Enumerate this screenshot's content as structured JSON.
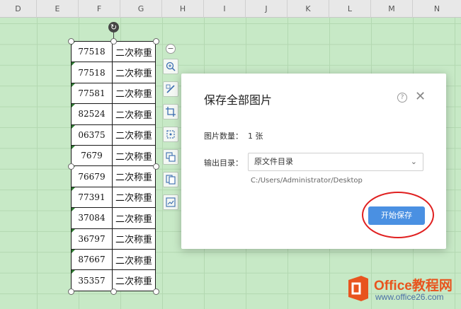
{
  "columns": [
    "D",
    "E",
    "F",
    "G",
    "H",
    "I",
    "J",
    "K",
    "L",
    "M",
    "N"
  ],
  "table": {
    "rows": [
      {
        "num": "77518",
        "txt": "二次称重"
      },
      {
        "num": "77518",
        "txt": "二次称重"
      },
      {
        "num": "77581",
        "txt": "二次称重"
      },
      {
        "num": "82524",
        "txt": "二次称重"
      },
      {
        "num": "06375",
        "txt": "二次称重"
      },
      {
        "num": "7679",
        "txt": "二次称重"
      },
      {
        "num": "76679",
        "txt": "二次称重"
      },
      {
        "num": "77391",
        "txt": "二次称重"
      },
      {
        "num": "37084",
        "txt": "二次称重"
      },
      {
        "num": "36797",
        "txt": "二次称重"
      },
      {
        "num": "87667",
        "txt": "二次称重"
      },
      {
        "num": "35357",
        "txt": "二次称重"
      }
    ]
  },
  "side_toolbar": {
    "icons": [
      "zoom-in-icon",
      "edit-image-icon",
      "crop-icon",
      "convert-icon",
      "extract-text-icon",
      "copy-image-icon",
      "save-image-icon"
    ]
  },
  "dialog": {
    "title": "保存全部图片",
    "count_label": "图片数量：",
    "count_value": "1 张",
    "output_label": "输出目录：",
    "output_selected": "原文件目录",
    "path": "C:/Users/Administrator/Desktop",
    "save_button": "开始保存",
    "close_glyph": "✕",
    "help_glyph": "?"
  },
  "watermark": {
    "line1": "Office教程网",
    "line2": "www.office26.com"
  },
  "colors": {
    "sheet_bg": "#c7e9c6",
    "primary_button": "#4a90e2",
    "highlight_circle": "#e02020"
  }
}
